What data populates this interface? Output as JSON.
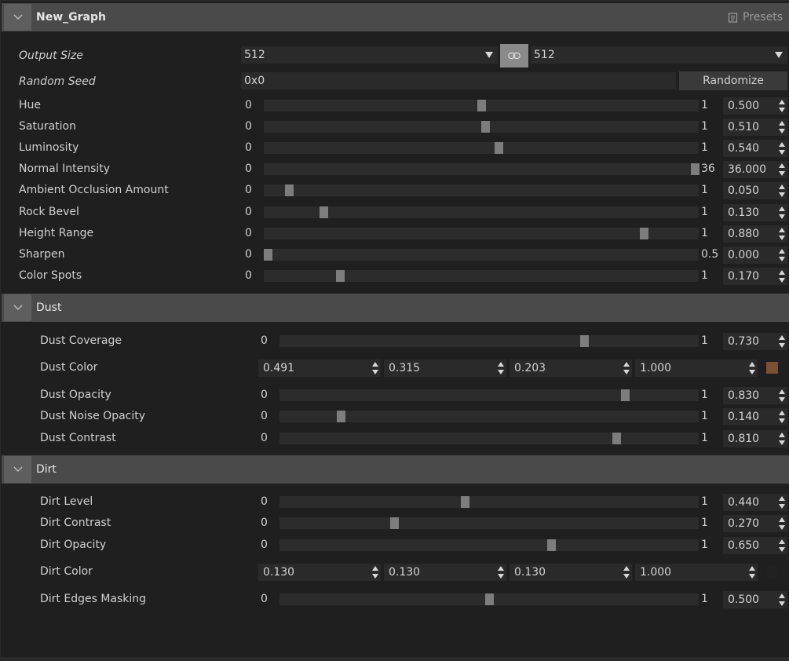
{
  "graph": {
    "title": "New_Graph",
    "presets_label": "Presets",
    "output_size": {
      "label": "Output Size",
      "value_a": "512",
      "value_b": "512"
    },
    "random_seed": {
      "label": "Random Seed",
      "value": "0x0",
      "button": "Randomize"
    },
    "sliders": [
      {
        "label": "Hue",
        "min": "0",
        "max": "1",
        "value": "0.500",
        "fraction": 0.5
      },
      {
        "label": "Saturation",
        "min": "0",
        "max": "1",
        "value": "0.510",
        "fraction": 0.51
      },
      {
        "label": "Luminosity",
        "min": "0",
        "max": "1",
        "value": "0.540",
        "fraction": 0.54
      },
      {
        "label": "Normal Intensity",
        "min": "0",
        "max": "36",
        "value": "36.000",
        "fraction": 1.0
      },
      {
        "label": "Ambient Occlusion Amount",
        "min": "0",
        "max": "1",
        "value": "0.050",
        "fraction": 0.05
      },
      {
        "label": "Rock Bevel",
        "min": "0",
        "max": "1",
        "value": "0.130",
        "fraction": 0.13
      },
      {
        "label": "Height Range",
        "min": "0",
        "max": "1",
        "value": "0.880",
        "fraction": 0.88
      },
      {
        "label": "Sharpen",
        "min": "0",
        "max": "0.5",
        "value": "0.000",
        "fraction": 0.0
      },
      {
        "label": "Color Spots",
        "min": "0",
        "max": "1",
        "value": "0.170",
        "fraction": 0.17
      }
    ]
  },
  "dust": {
    "title": "Dust",
    "sliders_top": [
      {
        "label": "Dust Coverage",
        "min": "0",
        "max": "1",
        "value": "0.730",
        "fraction": 0.73
      }
    ],
    "color": {
      "label": "Dust Color",
      "r": "0.491",
      "g": "0.315",
      "b": "0.203",
      "a": "1.000",
      "swatch": "#7d5034"
    },
    "sliders_bottom": [
      {
        "label": "Dust Opacity",
        "min": "0",
        "max": "1",
        "value": "0.830",
        "fraction": 0.83
      },
      {
        "label": "Dust Noise Opacity",
        "min": "0",
        "max": "1",
        "value": "0.140",
        "fraction": 0.14
      },
      {
        "label": "Dust Contrast",
        "min": "0",
        "max": "1",
        "value": "0.810",
        "fraction": 0.81
      }
    ]
  },
  "dirt": {
    "title": "Dirt",
    "sliders_top": [
      {
        "label": "Dirt Level",
        "min": "0",
        "max": "1",
        "value": "0.440",
        "fraction": 0.44
      },
      {
        "label": "Dirt Contrast",
        "min": "0",
        "max": "1",
        "value": "0.270",
        "fraction": 0.27
      },
      {
        "label": "Dirt Opacity",
        "min": "0",
        "max": "1",
        "value": "0.650",
        "fraction": 0.65
      }
    ],
    "color": {
      "label": "Dirt Color",
      "r": "0.130",
      "g": "0.130",
      "b": "0.130",
      "a": "1.000",
      "swatch": "#212121"
    },
    "sliders_bottom": [
      {
        "label": "Dirt Edges Masking",
        "min": "0",
        "max": "1",
        "value": "0.500",
        "fraction": 0.5
      }
    ]
  }
}
